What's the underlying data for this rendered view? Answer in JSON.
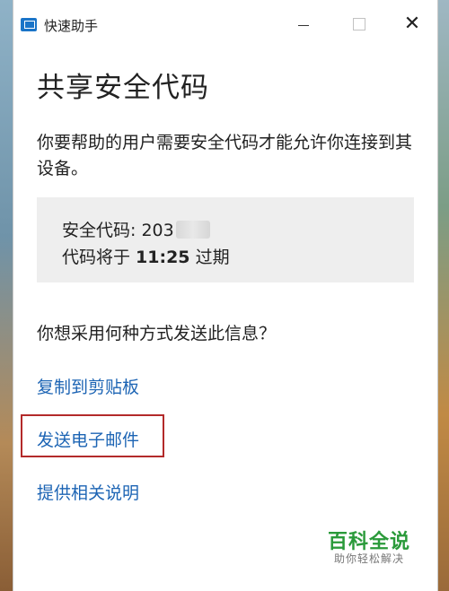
{
  "window": {
    "title": "快速助手",
    "min_glyph": "",
    "close_glyph": "✕"
  },
  "heading": "共享安全代码",
  "description": "你要帮助的用户需要安全代码才能允许你连接到其设备。",
  "code_box": {
    "code_label": "安全代码: ",
    "code_visible": "203",
    "expire_prefix": "代码将于 ",
    "expire_time": "11:25",
    "expire_suffix": " 过期"
  },
  "question": "你想采用何种方式发送此信息？",
  "links": {
    "copy": "复制到剪贴板",
    "email": "发送电子邮件",
    "help": "提供相关说明"
  },
  "watermark": {
    "title": "百科全说",
    "subtitle": "助你轻松解决"
  },
  "colors": {
    "link": "#1c64b4",
    "highlight_frame": "#b32a2a",
    "watermark_green": "#2a9a3a"
  }
}
